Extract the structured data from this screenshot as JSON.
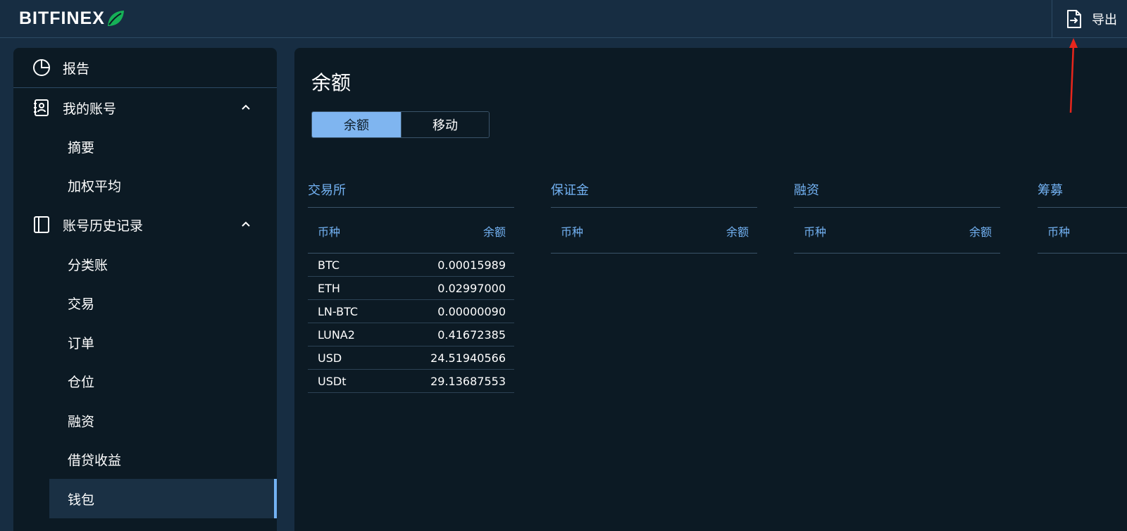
{
  "header": {
    "logo_text": "BITFINEX",
    "export_label": "导出"
  },
  "sidebar": {
    "reports": "报告",
    "my_account": {
      "label": "我的账号",
      "children": [
        "摘要",
        "加权平均"
      ]
    },
    "history": {
      "label": "账号历史记录",
      "children": [
        "分类账",
        "交易",
        "订单",
        "仓位",
        "融资",
        "借贷收益",
        "钱包"
      ]
    },
    "active_item": "钱包"
  },
  "main": {
    "title": "余额",
    "tabs": [
      {
        "label": "余额",
        "active": true
      },
      {
        "label": "移动",
        "active": false
      }
    ],
    "sections": [
      {
        "title": "交易所",
        "col_currency": "币种",
        "col_balance": "余额",
        "rows": [
          {
            "currency": "BTC",
            "balance": "0.00015989"
          },
          {
            "currency": "ETH",
            "balance": "0.02997000"
          },
          {
            "currency": "LN-BTC",
            "balance": "0.00000090"
          },
          {
            "currency": "LUNA2",
            "balance": "0.41672385"
          },
          {
            "currency": "USD",
            "balance": "24.51940566"
          },
          {
            "currency": "USDt",
            "balance": "29.13687553"
          }
        ]
      },
      {
        "title": "保证金",
        "col_currency": "币种",
        "col_balance": "余额",
        "rows": []
      },
      {
        "title": "融资",
        "col_currency": "币种",
        "col_balance": "余额",
        "rows": []
      },
      {
        "title": "筹募",
        "col_currency": "币种",
        "col_balance": "",
        "rows": []
      }
    ]
  },
  "colors": {
    "background": "#172d42",
    "panel": "#0c1a24",
    "accent": "#73b2f3",
    "tab_active": "#7fb5f0",
    "annotation_arrow": "#e8261c"
  },
  "icons": {
    "reports": "pie-chart-icon",
    "my_account": "contact-book-icon",
    "history": "journal-icon",
    "export": "file-export-icon",
    "expand": "chevron-up-icon",
    "logo_leaf": "leaf-icon"
  }
}
